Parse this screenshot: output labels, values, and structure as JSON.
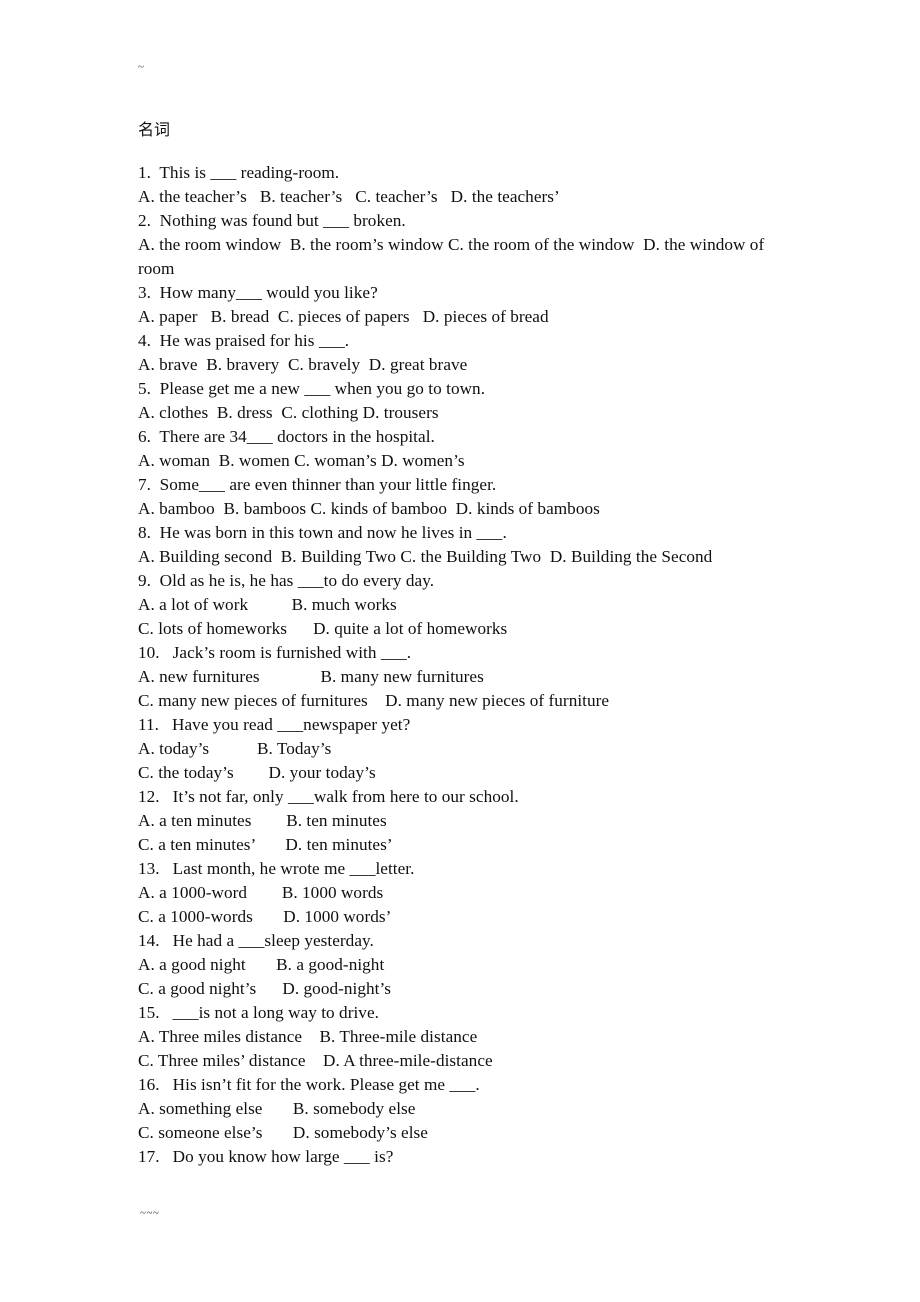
{
  "document": {
    "top_scan_mark": "~",
    "bottom_scan_mark": "~~~",
    "heading": "名词",
    "lines": [
      "1.  This is ___ reading-room.",
      "A. the teacher’s   B. teacher’s   C. teacher’s   D. the teachers’",
      "2.  Nothing was found but ___ broken.",
      "A. the room window  B. the room’s window C. the room of the window  D. the window of room",
      "3.  How many___ would you like?",
      "A. paper   B. bread  C. pieces of papers   D. pieces of bread",
      "4.  He was praised for his ___.",
      "A. brave  B. bravery  C. bravely  D. great brave",
      "5.  Please get me a new ___ when you go to town.",
      "A. clothes  B. dress  C. clothing D. trousers",
      "6.  There are 34___ doctors in the hospital.",
      "A. woman  B. women C. woman’s D. women’s",
      "7.  Some___ are even thinner than your little finger.",
      "A. bamboo  B. bamboos C. kinds of bamboo  D. kinds of bamboos",
      "8.  He was born in this town and now he lives in ___.",
      "A. Building second  B. Building Two C. the Building Two  D. Building the Second",
      "9.  Old as he is, he has ___to do every day.",
      "A. a lot of work          B. much works",
      "C. lots of homeworks      D. quite a lot of homeworks",
      "10.   Jack’s room is furnished with ___.",
      "A. new furnitures              B. many new furnitures",
      "C. many new pieces of furnitures    D. many new pieces of furniture",
      "11.   Have you read ___newspaper yet?",
      "A. today’s           B. Today’s",
      "C. the today’s        D. your today’s",
      "12.   It’s not far, only ___walk from here to our school.",
      "A. a ten minutes        B. ten minutes",
      "C. a ten minutes’       D. ten minutes’",
      "13.   Last month, he wrote me ___letter.",
      "A. a 1000-word        B. 1000 words",
      "C. a 1000-words       D. 1000 words’",
      "14.   He had a ___sleep yesterday.",
      "A. a good night       B. a good-night",
      "C. a good night’s      D. good-night’s",
      "15.   ___is not a long way to drive.",
      "A. Three miles distance    B. Three-mile distance",
      "C. Three miles’ distance    D. A three-mile-distance",
      "16.   His isn’t fit for the work. Please get me ___.",
      "A. something else       B. somebody else",
      "C. someone else’s       D. somebody’s else",
      "17.   Do you know how large ___ is?"
    ]
  }
}
